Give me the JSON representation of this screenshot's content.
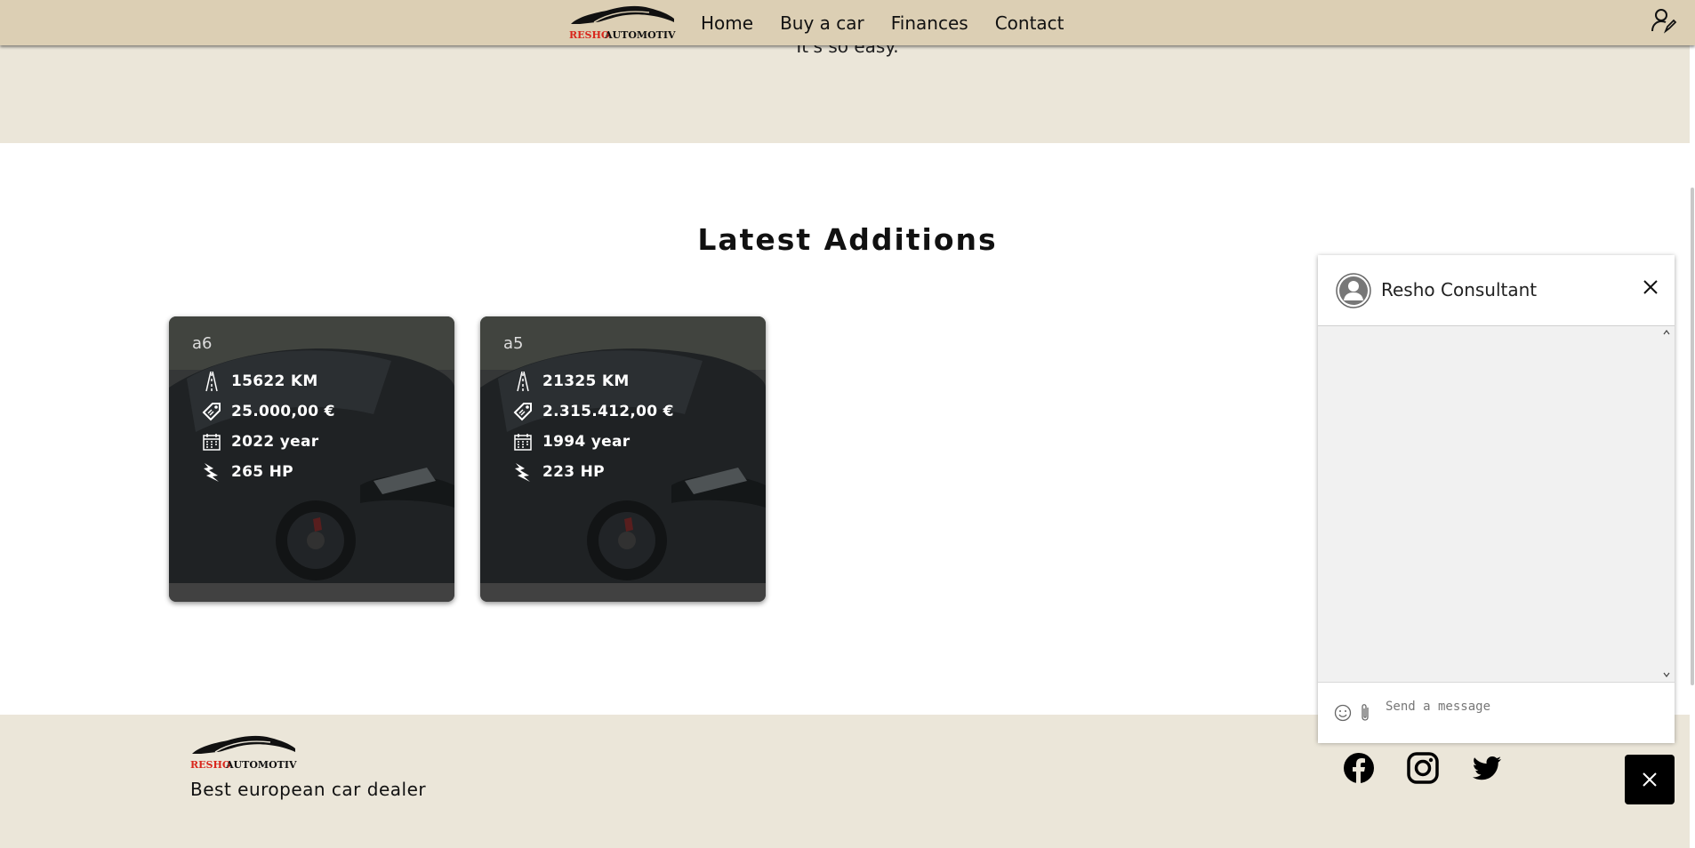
{
  "nav": {
    "brand_red": "RESHO",
    "brand_black": "AUTOMOTIVE",
    "links": [
      "Home",
      "Buy a car",
      "Finances",
      "Contact"
    ]
  },
  "hero": {
    "text": "It's so easy."
  },
  "section": {
    "title": "Latest Additions"
  },
  "cards": [
    {
      "title": "a6",
      "km": "15622 KM",
      "price": "25.000,00 €",
      "year": "2022 year",
      "hp": "265 HP"
    },
    {
      "title": "a5",
      "km": "21325 KM",
      "price": "2.315.412,00 €",
      "year": "1994 year",
      "hp": "223 HP"
    }
  ],
  "chat": {
    "title": "Resho Consultant",
    "close_label": "X",
    "input_placeholder": "Send a message"
  },
  "footer": {
    "brand_red": "RESHO",
    "brand_black": "AUTOMOTIVE",
    "tagline": "Best european car dealer"
  },
  "icons": {
    "user": "user-edit-icon",
    "km": "road-icon",
    "price": "price-tag-icon",
    "year": "calendar-icon",
    "hp": "lightning-icon",
    "facebook": "facebook-icon",
    "instagram": "instagram-icon",
    "twitter": "twitter-icon"
  },
  "colors": {
    "nav_bg": "#dccfb4",
    "hero_bg": "#ebe6d9",
    "brand_red": "#d9261c",
    "chat_toggle": "#000000"
  }
}
